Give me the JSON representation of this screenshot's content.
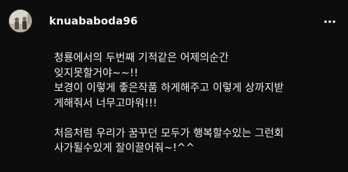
{
  "post": {
    "username": "knuababoda96",
    "avatar_icon": "profile-photo",
    "more_icon": "more-options-icon",
    "caption_paragraph_1": [
      "청룡에서의 두번째 기적같은 어제의순간",
      "잊지못할거야~~!!",
      "보경이 이렇게 좋은작품 하게해주고 이렇게 상까지받",
      "게해줘서 너무고마워!!!"
    ],
    "caption_paragraph_2": [
      "처음처럼 우리가 꿈꾸던 모두가 행복할수있는 그런회",
      "사가될수있게 잘이끌어줘~!^^"
    ]
  },
  "colors": {
    "background": "#0d0d0d",
    "text": "#f0f0f0"
  }
}
